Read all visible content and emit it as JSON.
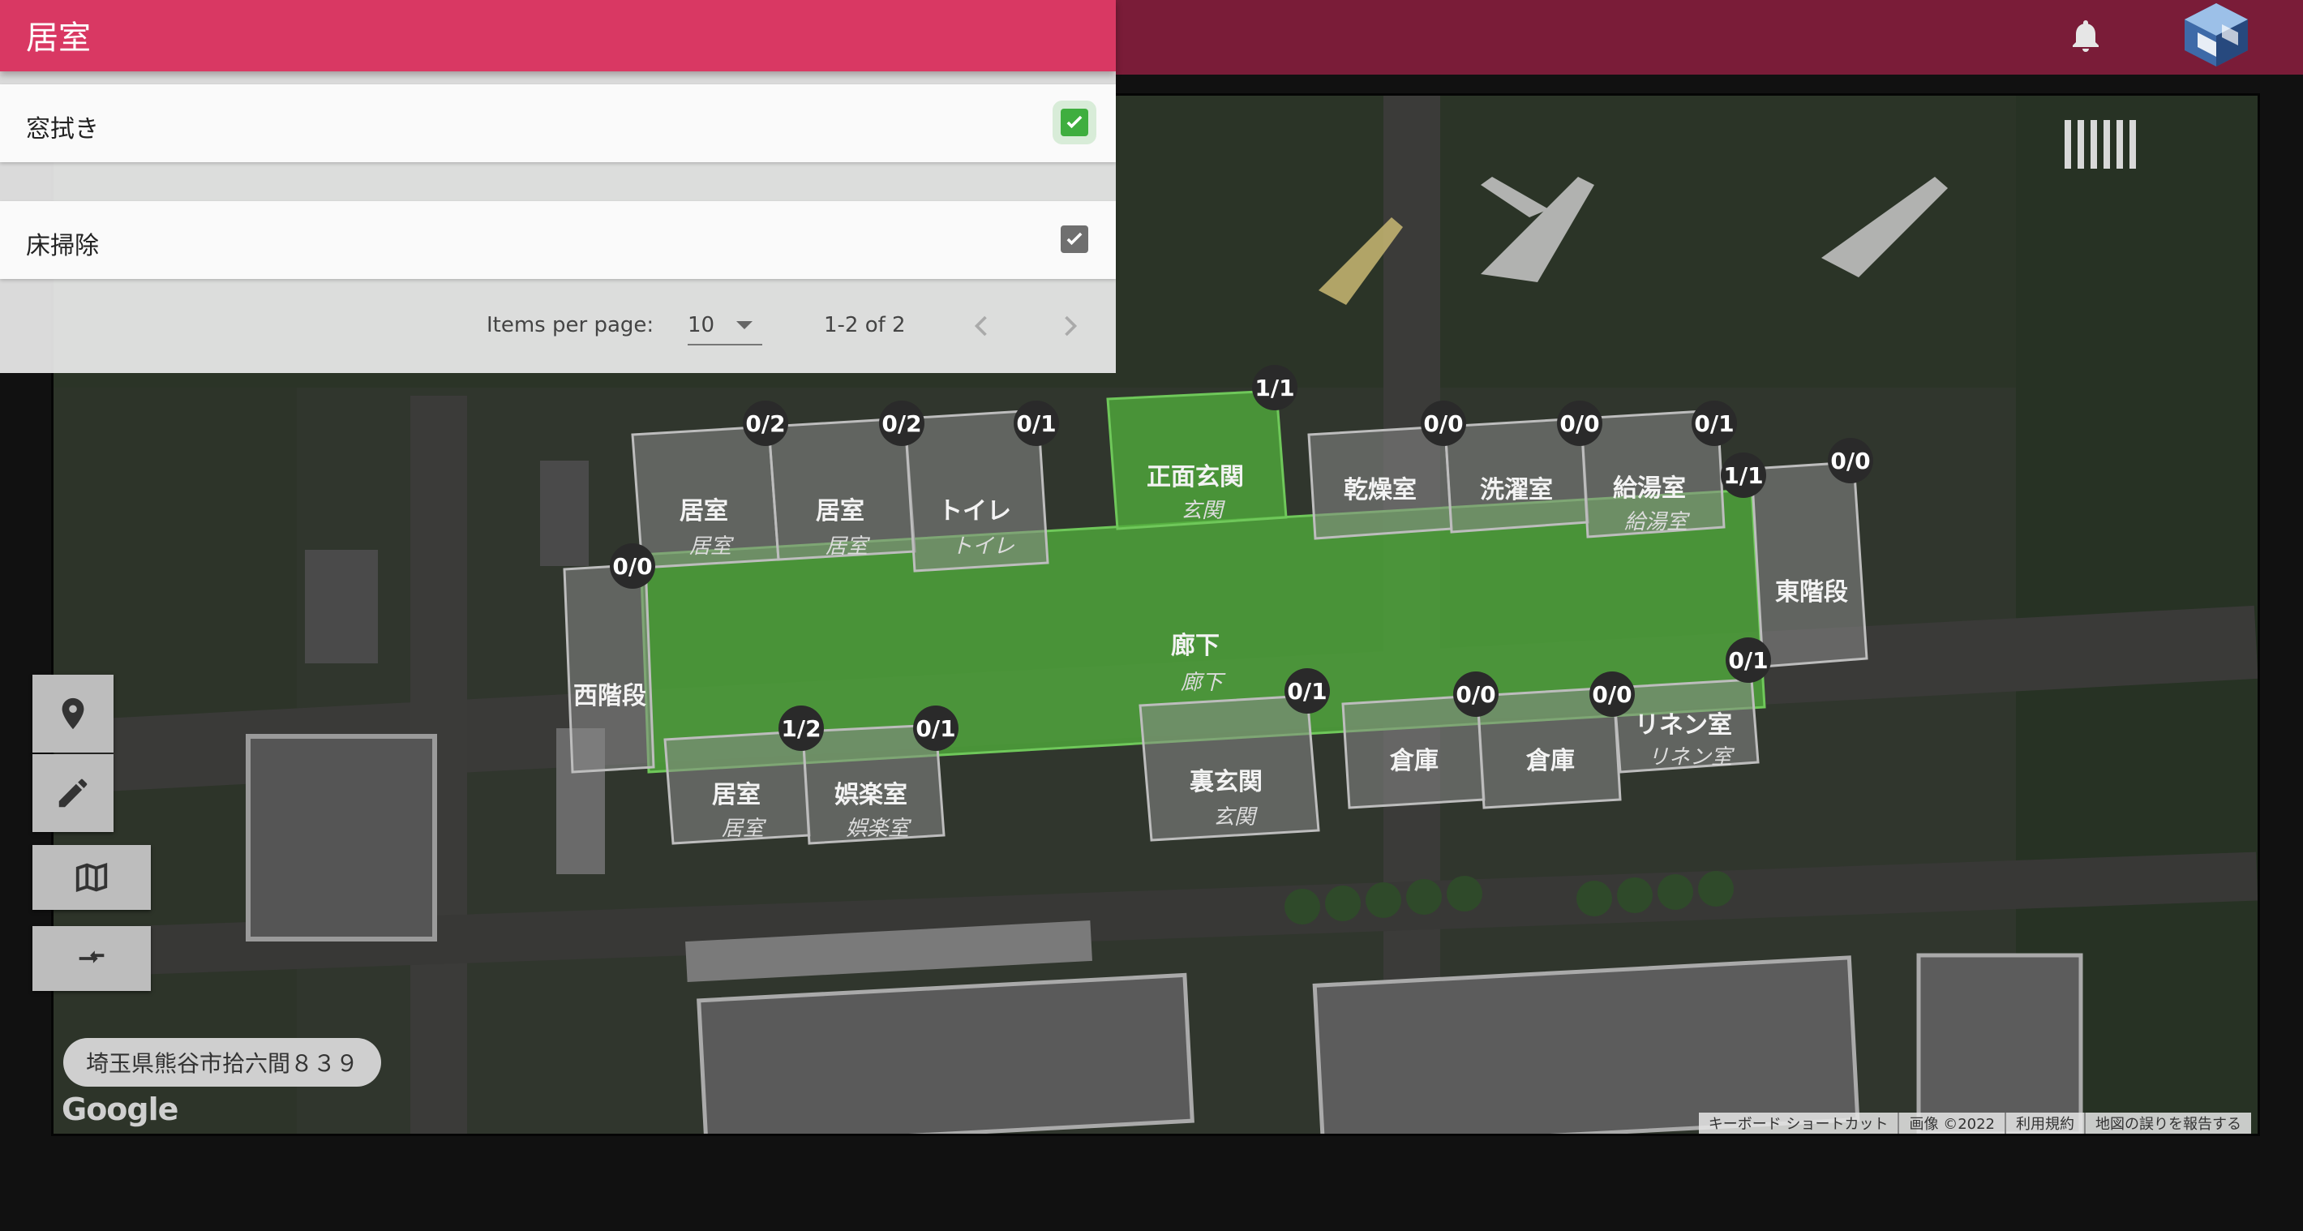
{
  "panel": {
    "title": "居室",
    "tasks": [
      {
        "label": "窓拭き",
        "checked": true,
        "style": "green"
      },
      {
        "label": "床掃除",
        "checked": true,
        "style": "grey"
      }
    ],
    "paginator": {
      "items_per_page_label": "Items per page:",
      "items_per_page": "10",
      "range": "1-2 of 2"
    }
  },
  "map": {
    "address": "埼玉県熊谷市拾六間８３９",
    "logo": "Google",
    "attribution": [
      "キーボード ショートカット",
      "画像 ©2022",
      "利用規約",
      "地図の誤りを報告する"
    ]
  },
  "zones": [
    {
      "name": "居室",
      "sub": "居室",
      "count": "0/2",
      "done": false
    },
    {
      "name": "居室",
      "sub": "居室",
      "count": "0/2",
      "done": false
    },
    {
      "name": "トイレ",
      "sub": "トイレ",
      "count": "0/1",
      "done": false
    },
    {
      "name": "正面玄関",
      "sub": "玄関",
      "count": "1/1",
      "done": true
    },
    {
      "name": "乾燥室",
      "sub": "",
      "count": "0/0",
      "done": false
    },
    {
      "name": "洗濯室",
      "sub": "",
      "count": "0/0",
      "done": false
    },
    {
      "name": "給湯室",
      "sub": "給湯室",
      "count": "0/1",
      "done": false
    },
    {
      "name": "東階段",
      "sub": "",
      "count": "0/0",
      "done": false
    },
    {
      "name": "西階段",
      "sub": "",
      "count": "0/0",
      "done": false
    },
    {
      "name": "廊下",
      "sub": "廊下",
      "count": "1/1",
      "done": true
    },
    {
      "name": "居室",
      "sub": "居室",
      "count": "1/2",
      "done": false
    },
    {
      "name": "娯楽室",
      "sub": "娯楽室",
      "count": "0/1",
      "done": false
    },
    {
      "name": "裏玄関",
      "sub": "玄関",
      "count": "0/1",
      "done": false
    },
    {
      "name": "倉庫",
      "sub": "",
      "count": "0/0",
      "done": false
    },
    {
      "name": "倉庫",
      "sub": "",
      "count": "0/0",
      "done": false
    },
    {
      "name": "リネン室",
      "sub": "リネン室",
      "count": "0/1",
      "done": false
    }
  ],
  "colors": {
    "header": "#d93863",
    "topbar": "#7a1c38",
    "done_zone": "#4fa83a",
    "todo_zone": "#8a8a8a"
  },
  "icons": {
    "topbar": [
      "bell-icon",
      "avatar-logo"
    ],
    "controls": [
      "location-pin-icon",
      "pencil-icon",
      "map-icon",
      "swap-icon"
    ]
  }
}
